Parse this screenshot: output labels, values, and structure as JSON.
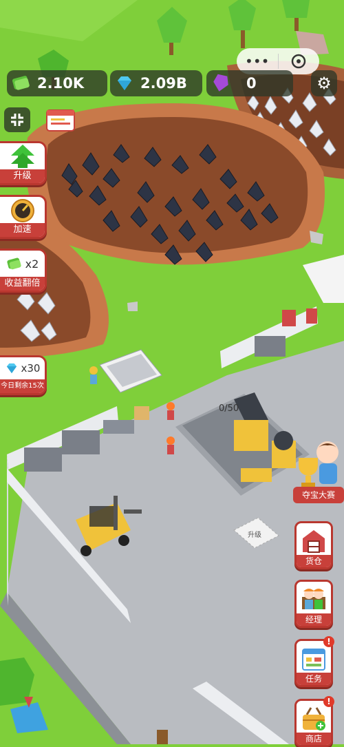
{
  "hud": {
    "cash": "2.10K",
    "diamonds": "2.09B",
    "gems": "0"
  },
  "left_buttons": {
    "upgrade": "升级",
    "speed": "加速",
    "double_label": "x2",
    "double_caption": "收益翻倍",
    "diamond_count": "x30",
    "diamond_caption": "今日剩余15次"
  },
  "right_buttons": {
    "treasure": "夺宝大赛",
    "warehouse": "货仓",
    "manager": "经理",
    "tasks": "任务",
    "shop": "商店"
  },
  "scene": {
    "crusher_capacity": "0/50",
    "upgrade_tile": "升级"
  },
  "colors": {
    "grass": "#7fcf3a",
    "floor": "#b9bcc1",
    "dirt": "#a8613a",
    "button_red": "#c8403a"
  }
}
